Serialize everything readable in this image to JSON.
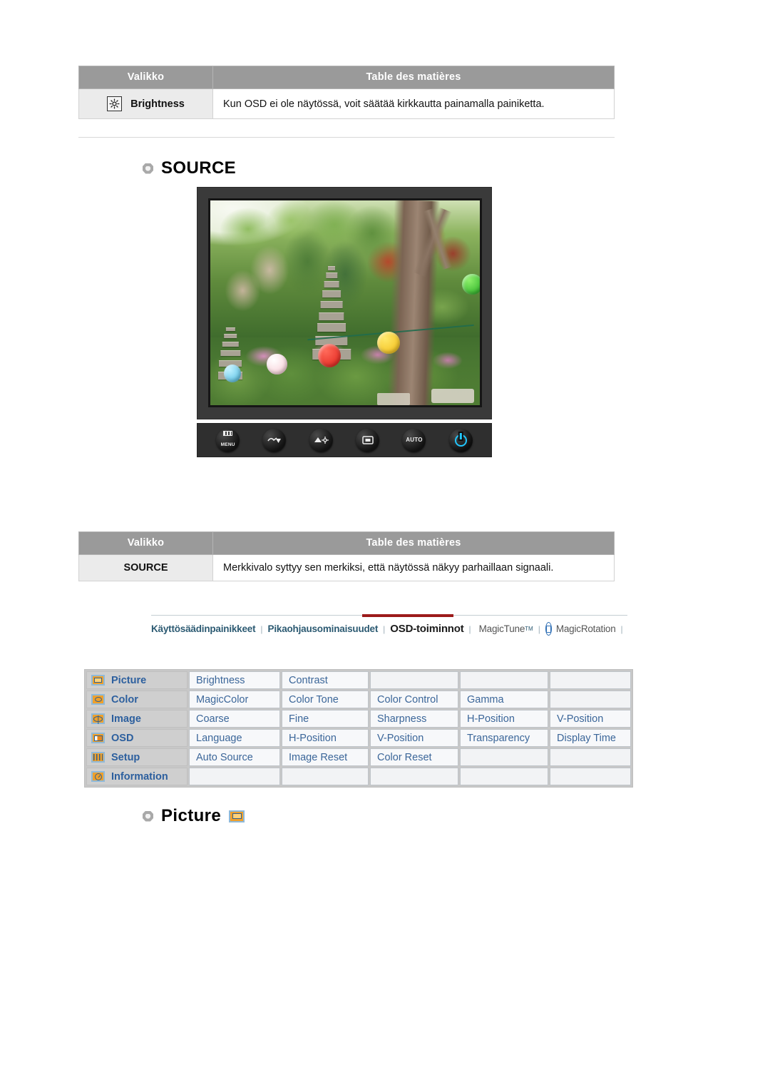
{
  "brightness_table": {
    "headers": [
      "Valikko",
      "Table des matières"
    ],
    "row": {
      "icon": "brightness-sun-icon",
      "menu": "Brightness",
      "description": "Kun OSD ei ole näytössä, voit säätää kirkkautta painamalla painiketta."
    }
  },
  "source_section": {
    "heading": "SOURCE"
  },
  "monitor": {
    "photo_alt": "Korean garden with stone pagoda, trees and paper lanterns",
    "buttons": [
      {
        "name": "menu-button",
        "label": "MENU"
      },
      {
        "name": "down-button",
        "label": ""
      },
      {
        "name": "up-brightness-button",
        "label": ""
      },
      {
        "name": "enter-source-button",
        "label": ""
      },
      {
        "name": "auto-button",
        "label": "AUTO"
      },
      {
        "name": "power-button",
        "label": ""
      }
    ]
  },
  "source_table": {
    "headers": [
      "Valikko",
      "Table des matières"
    ],
    "row": {
      "menu": "SOURCE",
      "description": "Merkkivalo syttyy sen merkiksi, että näytössä näkyy parhaillaan signaali."
    }
  },
  "navbar": {
    "items": [
      {
        "label": "Käyttösäädinpainikkeet",
        "active": false,
        "logo": null
      },
      {
        "label": "Pikaohjausominaisuudet",
        "active": false,
        "logo": null
      },
      {
        "label": "OSD-toiminnot",
        "active": true,
        "logo": null
      },
      {
        "label": "MagicTune",
        "active": false,
        "logo": "magictune-logo",
        "tm": "TM"
      },
      {
        "label": "MagicRotation",
        "active": false,
        "logo": "magicrotation-logo",
        "tm": ""
      }
    ],
    "separator": "|",
    "active_color": "#9c1b1b"
  },
  "osd_map": {
    "rows": [
      {
        "icon": "picture-icon",
        "category": "Picture",
        "items": [
          "Brightness",
          "Contrast",
          "",
          "",
          ""
        ]
      },
      {
        "icon": "color-icon",
        "category": "Color",
        "items": [
          "MagicColor",
          "Color Tone",
          "Color Control",
          "Gamma",
          ""
        ]
      },
      {
        "icon": "image-icon",
        "category": "Image",
        "items": [
          "Coarse",
          "Fine",
          "Sharpness",
          "H-Position",
          "V-Position"
        ]
      },
      {
        "icon": "osd-icon",
        "category": "OSD",
        "items": [
          "Language",
          "H-Position",
          "V-Position",
          "Transparency",
          "Display Time"
        ]
      },
      {
        "icon": "setup-icon",
        "category": "Setup",
        "items": [
          "Auto Source",
          "Image Reset",
          "Color Reset",
          "",
          ""
        ]
      },
      {
        "icon": "information-icon",
        "category": "Information",
        "items": [
          "",
          "",
          "",
          "",
          ""
        ]
      }
    ]
  },
  "picture_section": {
    "heading": "Picture",
    "icon": "picture-icon"
  },
  "colors": {
    "table_header_bg": "#9a9a9a",
    "menu_cell_bg": "#ebebeb",
    "osd_text": "#3b6699",
    "osd_cat_bg": "#cfcfcf",
    "nav_text": "#2c5a72",
    "nav_active_bar": "#9c1b1b",
    "icon_orange": "#f0a02a",
    "icon_border_blue": "#8fb9d9"
  }
}
